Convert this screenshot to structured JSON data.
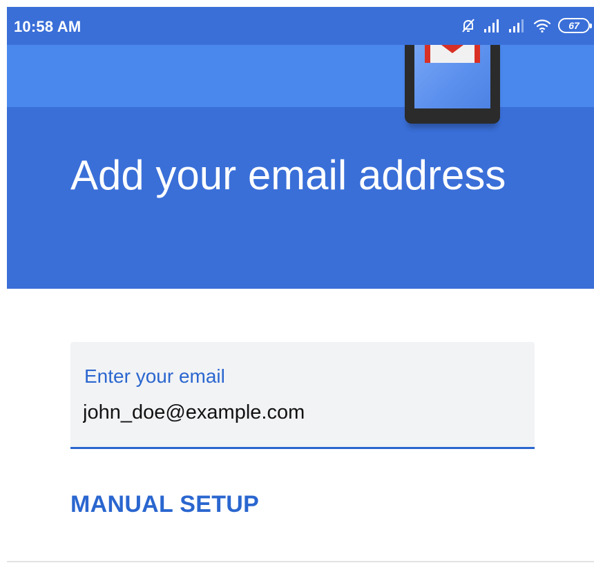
{
  "status_bar": {
    "time": "10:58 AM",
    "battery_level": "67",
    "icons": [
      "notifications-off-icon",
      "signal-strength-icon",
      "signal-strength-icon",
      "wifi-icon",
      "battery-icon"
    ]
  },
  "header": {
    "title": "Add your email address"
  },
  "email_field": {
    "label": "Enter your email",
    "value": "john_doe@example.com"
  },
  "actions": {
    "manual_setup_label": "MANUAL SETUP"
  },
  "colors": {
    "brand_blue": "#3a6fd8",
    "band_blue": "#4a88ee",
    "accent_blue": "#2a66cf",
    "field_background": "#f2f3f5"
  }
}
